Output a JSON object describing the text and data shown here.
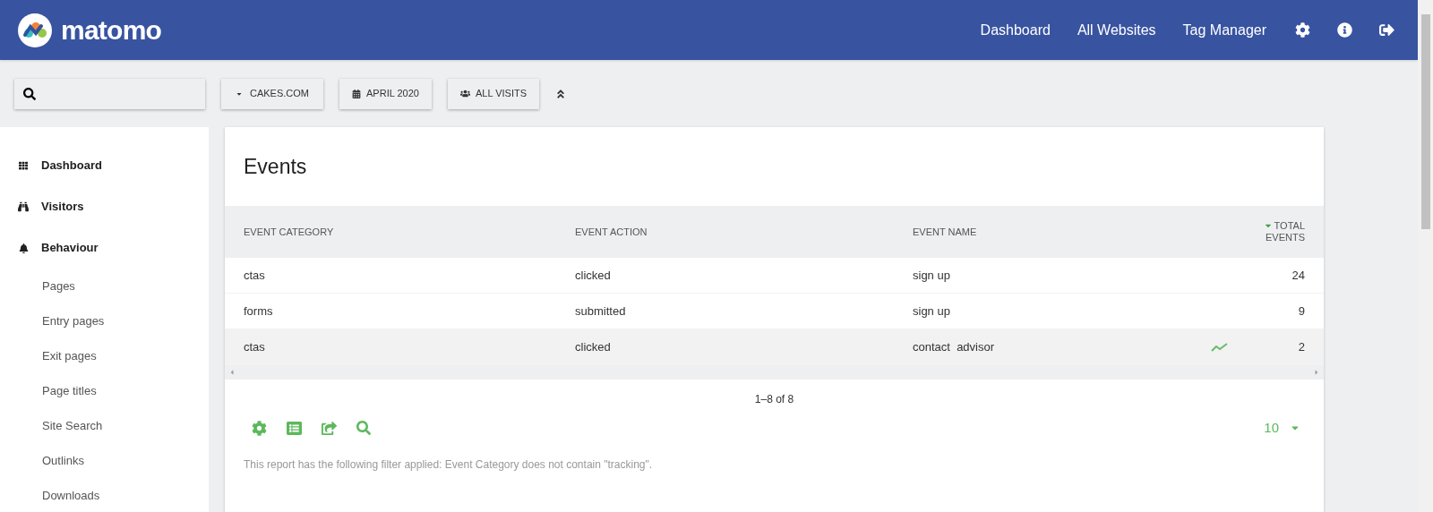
{
  "header": {
    "logo": "matomo",
    "links": [
      "Dashboard",
      "All Websites",
      "Tag Manager"
    ]
  },
  "toolbar": {
    "site": "CAKES.COM",
    "period": "APRIL 2020",
    "segment": "ALL VISITS"
  },
  "sidebar": {
    "items": [
      {
        "label": "Dashboard",
        "kind": "section"
      },
      {
        "label": "Visitors",
        "kind": "section"
      },
      {
        "label": "Behaviour",
        "kind": "section"
      },
      {
        "label": "Pages",
        "kind": "sub"
      },
      {
        "label": "Entry pages",
        "kind": "sub"
      },
      {
        "label": "Exit pages",
        "kind": "sub"
      },
      {
        "label": "Page titles",
        "kind": "sub"
      },
      {
        "label": "Site Search",
        "kind": "sub"
      },
      {
        "label": "Outlinks",
        "kind": "sub"
      },
      {
        "label": "Downloads",
        "kind": "sub"
      }
    ]
  },
  "report": {
    "title": "Events",
    "columns": [
      {
        "label": "EVENT CATEGORY",
        "sorted": false
      },
      {
        "label": "EVENT ACTION",
        "sorted": false
      },
      {
        "label": "EVENT NAME",
        "sorted": false
      },
      {
        "label": "TOTAL EVENTS",
        "sorted": true
      }
    ],
    "rows": [
      {
        "cells": [
          "ctas",
          "clicked",
          "sign up",
          "24"
        ],
        "hovered": false
      },
      {
        "cells": [
          "forms",
          "submitted",
          "sign up",
          "9"
        ],
        "hovered": false
      },
      {
        "cells": [
          "ctas",
          "clicked",
          "contact  advisor",
          "2"
        ],
        "hovered": true
      }
    ],
    "pagination": "1–8 of 8",
    "limit": "10",
    "filter_note": "This report has the following filter applied: Event Category does not contain \"tracking\"."
  }
}
